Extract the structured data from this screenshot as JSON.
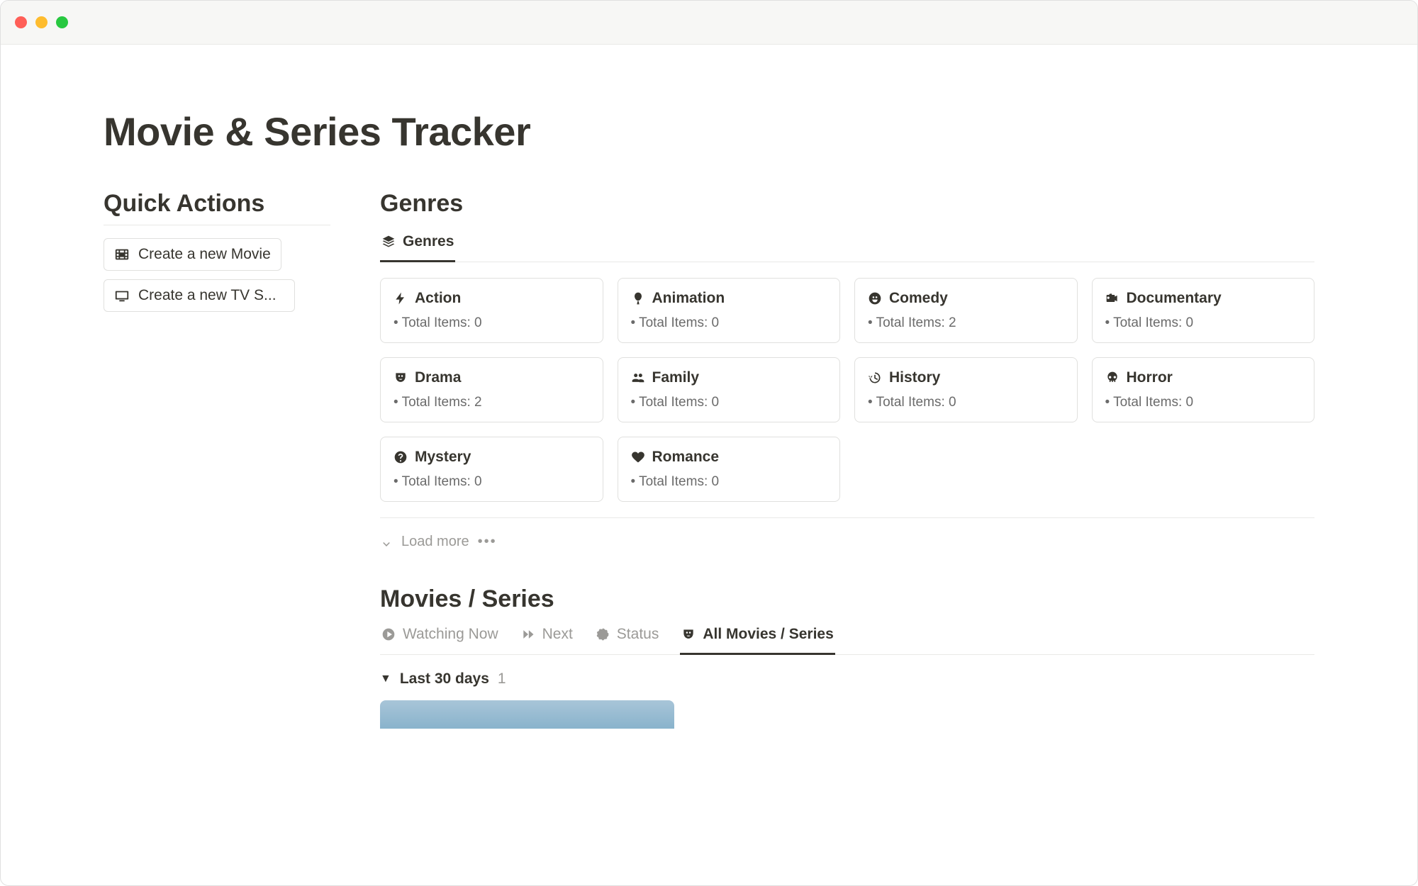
{
  "page": {
    "title": "Movie & Series Tracker"
  },
  "quickActions": {
    "heading": "Quick Actions",
    "actions": [
      {
        "label": "Create a new Movie",
        "icon": "film-icon"
      },
      {
        "label": "Create a new TV S...",
        "icon": "tv-icon"
      }
    ]
  },
  "genres": {
    "heading": "Genres",
    "tab": {
      "label": "Genres",
      "icon": "layers-icon"
    },
    "meta_prefix": "• Total Items: ",
    "items": [
      {
        "name": "Action",
        "count": 0,
        "icon": "bolt-icon"
      },
      {
        "name": "Animation",
        "count": 0,
        "icon": "balloon-icon"
      },
      {
        "name": "Comedy",
        "count": 2,
        "icon": "smile-icon"
      },
      {
        "name": "Documentary",
        "count": 0,
        "icon": "camera-icon"
      },
      {
        "name": "Drama",
        "count": 2,
        "icon": "mask-icon"
      },
      {
        "name": "Family",
        "count": 0,
        "icon": "people-icon"
      },
      {
        "name": "History",
        "count": 0,
        "icon": "history-icon"
      },
      {
        "name": "Horror",
        "count": 0,
        "icon": "skull-icon"
      },
      {
        "name": "Mystery",
        "count": 0,
        "icon": "question-icon"
      },
      {
        "name": "Romance",
        "count": 0,
        "icon": "heart-icon"
      }
    ],
    "load_more": "Load more"
  },
  "movies": {
    "heading": "Movies / Series",
    "tabs": [
      {
        "label": "Watching Now",
        "icon": "play-icon",
        "active": false
      },
      {
        "label": "Next",
        "icon": "forward-icon",
        "active": false
      },
      {
        "label": "Status",
        "icon": "dashed-circle-icon",
        "active": false
      },
      {
        "label": "All Movies / Series",
        "icon": "mask-icon",
        "active": true
      }
    ],
    "group": {
      "label": "Last 30 days",
      "count": 1
    }
  }
}
